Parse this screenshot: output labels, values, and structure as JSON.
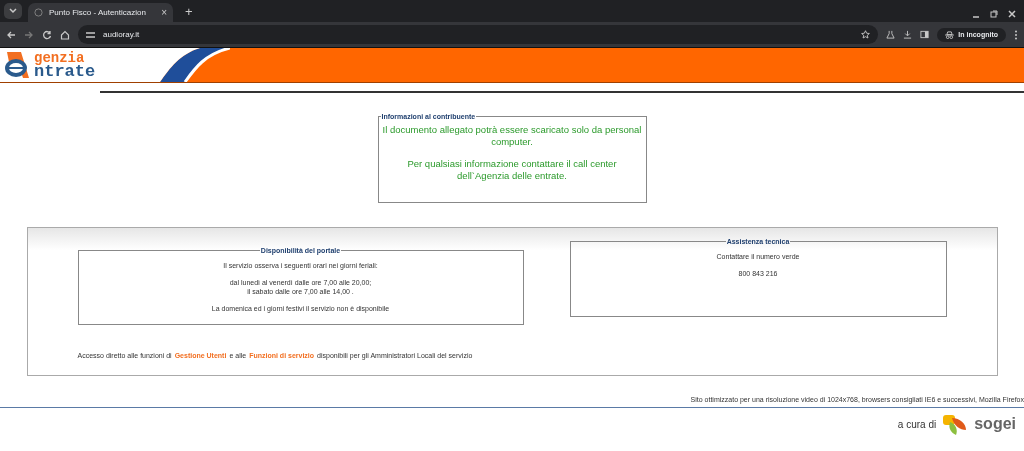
{
  "browser": {
    "tab_title": "Punto Fisco - Autenticazion",
    "tab_close": "×",
    "new_tab": "+",
    "address": "audioray.it",
    "incognito": "In incognito"
  },
  "header": {
    "logo_lines": [
      "genzia",
      "ntrate"
    ]
  },
  "info": {
    "legend": "Informazioni al contribuente",
    "paragraphs": [
      "Il documento allegato potrà essere scaricato solo da personal computer.",
      "Per qualsiasi informazione contattare il call center dell`Agenzia delle entrate."
    ]
  },
  "availability": {
    "legend": "Disponibilità del portale",
    "paragraphs": [
      [
        "Il servizio osserva i seguenti orari nei giorni feriali:"
      ],
      [
        "dal lunedì al venerdì dalle ore 7,00 alle 20,00;",
        "il sabato dalle ore 7,00 alle 14,00 ."
      ],
      [
        "La domenica ed i giorni festivi il servizio non è disponibile"
      ]
    ]
  },
  "support": {
    "legend": "Assistenza tecnica",
    "paragraphs": [
      "Contattare il numero verde",
      "800 843 216"
    ]
  },
  "access_line": [
    {
      "kind": "text",
      "text": "Accesso diretto alle funzioni di"
    },
    {
      "kind": "link",
      "text": "Gestione Utenti"
    },
    {
      "kind": "text",
      "text": "e alle"
    },
    {
      "kind": "link",
      "text": "Funzioni di servizio"
    },
    {
      "kind": "text",
      "text": "disponibili per gli Amministratori Locali del servizio"
    }
  ],
  "footer": {
    "note": "Sito ottimizzato per una risoluzione video di 1024x768, browsers consigliati IE6 e successivi, Mozilla Firefox",
    "credit": "a cura di",
    "brand": "sogei"
  }
}
